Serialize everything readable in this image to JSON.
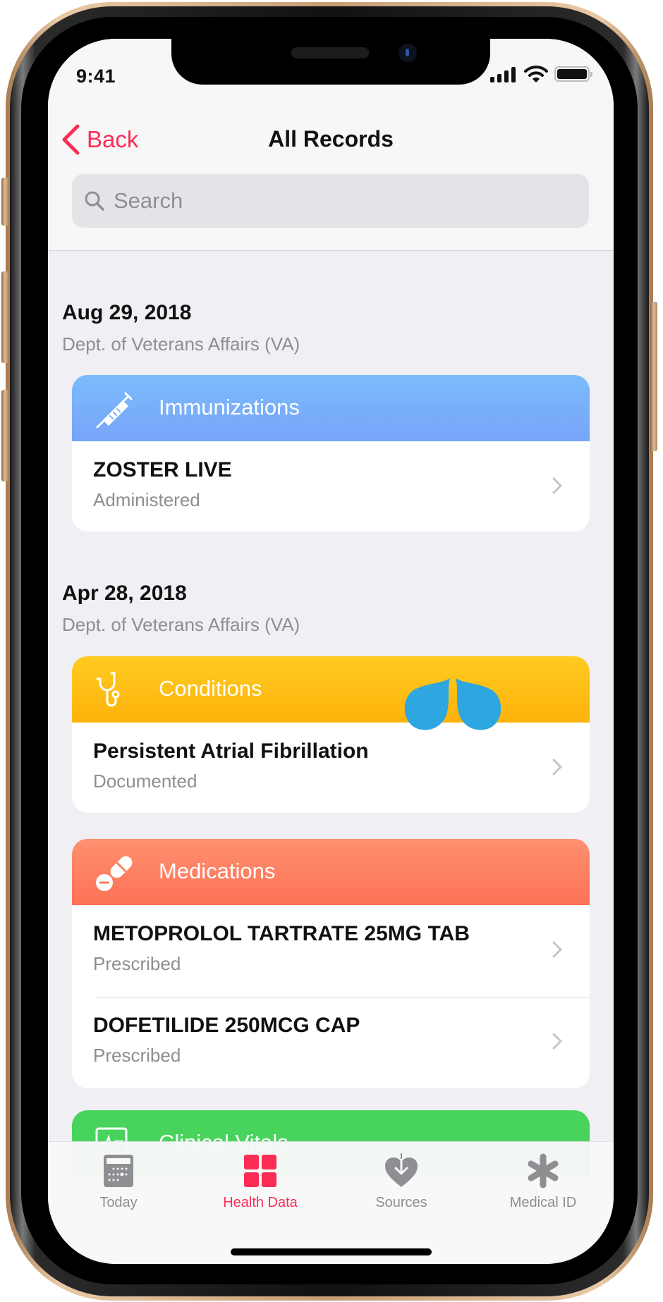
{
  "status_bar": {
    "time": "9:41",
    "icons": [
      "cellular-signal-icon",
      "wifi-icon",
      "battery-icon"
    ]
  },
  "nav": {
    "back_label": "Back",
    "title": "All Records"
  },
  "search": {
    "placeholder": "Search",
    "value": ""
  },
  "sections": [
    {
      "date": "Aug 29, 2018",
      "source": "Dept. of Veterans Affairs (VA)",
      "cards": [
        {
          "category": "Immunizations",
          "icon": "syringe-icon",
          "color": "#7BB9FC",
          "items": [
            {
              "title": "ZOSTER LIVE",
              "status": "Administered"
            }
          ]
        }
      ]
    },
    {
      "date": "Apr 28, 2018",
      "source": "Dept. of Veterans Affairs (VA)",
      "cards": [
        {
          "category": "Conditions",
          "icon": "stethoscope-icon",
          "color": "#FFC21A",
          "items": [
            {
              "title": "Persistent Atrial Fibrillation",
              "status": "Documented"
            }
          ]
        },
        {
          "category": "Medications",
          "icon": "pills-icon",
          "color": "#FE8265",
          "items": [
            {
              "title": "METOPROLOL TARTRATE 25MG TAB",
              "status": "Prescribed"
            },
            {
              "title": "DOFETILIDE 250MCG CAP",
              "status": "Prescribed"
            }
          ]
        },
        {
          "category": "Clinical Vitals",
          "icon": "vitals-monitor-icon",
          "color": "#48D35C",
          "items": []
        }
      ]
    }
  ],
  "tab_bar": {
    "tabs": [
      {
        "label": "Today",
        "icon": "calendar-icon",
        "active": false
      },
      {
        "label": "Health Data",
        "icon": "grid-icon",
        "active": true
      },
      {
        "label": "Sources",
        "icon": "heart-download-icon",
        "active": false
      },
      {
        "label": "Medical ID",
        "icon": "asterisk-icon",
        "active": false
      }
    ]
  },
  "overlay": {
    "gesture": "pinch-gesture-indicator",
    "color": "#2EA6DF"
  },
  "colors": {
    "accent": "#FB2D55",
    "secondary_text": "#8E8E93",
    "background": "#EFEFF4"
  }
}
